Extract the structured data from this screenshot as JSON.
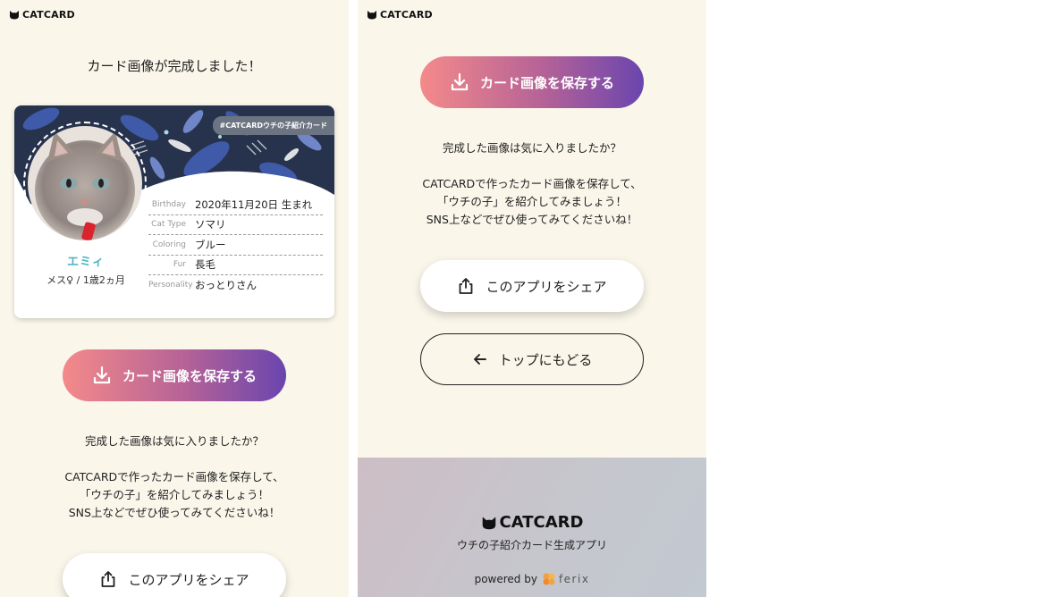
{
  "app": {
    "logo_text": "CATCARD"
  },
  "left": {
    "headline": "カード画像が完成しました！",
    "card": {
      "hashtag": "#CATCARDウチの子紹介カード",
      "cat_name": "エミィ",
      "cat_sub": "メス♀ / 1歳2ヵ月",
      "fields": [
        {
          "key": "Birthday",
          "value": "2020年11月20日 生まれ"
        },
        {
          "key": "Cat Type",
          "value": "ソマリ"
        },
        {
          "key": "Coloring",
          "value": "ブルー"
        },
        {
          "key": "Fur",
          "value": "長毛"
        },
        {
          "key": "Personality",
          "value": "おっとりさん"
        }
      ]
    },
    "save_label": "カード画像を保存する",
    "message": [
      "完成した画像は気に入りましたか？",
      "",
      "CATCARDで作ったカード画像を保存して、",
      "「ウチの子」を紹介してみましょう！",
      "SNS上などでぜひ使ってみてくださいね！"
    ],
    "share_label": "このアプリをシェア"
  },
  "right": {
    "save_label": "カード画像を保存する",
    "message": [
      "完成した画像は気に入りましたか？",
      "",
      "CATCARDで作ったカード画像を保存して、",
      "「ウチの子」を紹介してみましょう！",
      "SNS上などでぜひ使ってみてくださいね！"
    ],
    "share_label": "このアプリをシェア",
    "back_label": "トップにもどる"
  },
  "footer": {
    "logo_text": "CATCARD",
    "subtitle": "ウチの子紹介カード生成アプリ",
    "powered_by": "powered by",
    "company": "ferix"
  },
  "colors": {
    "background": "#faf6ea",
    "accent_start": "#f48a8a",
    "accent_end": "#6a45ae",
    "name_color": "#4bb3c6"
  }
}
